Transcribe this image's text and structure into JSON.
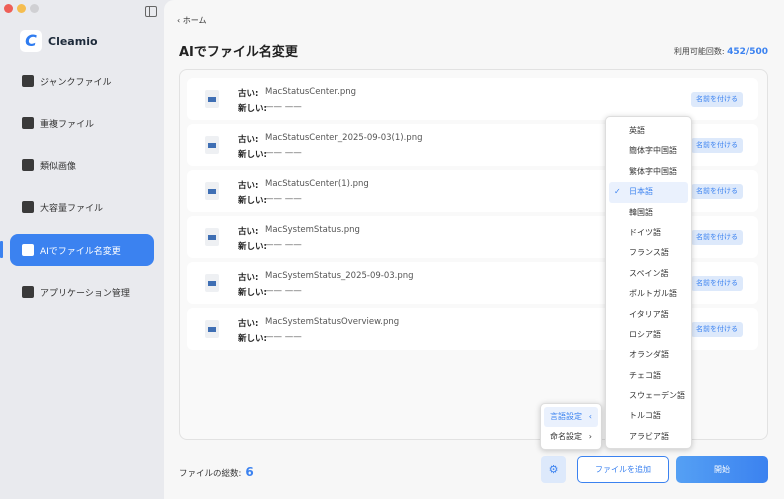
{
  "app": {
    "name": "Cleamio"
  },
  "sidebar": {
    "items": [
      {
        "label": "ジャンクファイル",
        "icon": "broom-icon"
      },
      {
        "label": "重複ファイル",
        "icon": "folder-icon"
      },
      {
        "label": "類似画像",
        "icon": "image-icon"
      },
      {
        "label": "大容量ファイル",
        "icon": "archive-icon"
      },
      {
        "label": "AIでファイル名変更",
        "icon": "ai-file-icon",
        "active": true
      },
      {
        "label": "アプリケーション管理",
        "icon": "app-store-icon"
      }
    ]
  },
  "header": {
    "back": "ホーム",
    "title": "AIでファイル名変更",
    "usage_label": "利用可能回数:",
    "usage_value": "452/500"
  },
  "files": [
    {
      "old_label": "古い:",
      "old": "MacStatusCenter.png",
      "new_label": "新しい:",
      "new": "—— ——",
      "action": "名前を付ける"
    },
    {
      "old_label": "古い:",
      "old": "MacStatusCenter_2025-09-03(1).png",
      "new_label": "新しい:",
      "new": "—— ——",
      "action": "名前を付ける"
    },
    {
      "old_label": "古い:",
      "old": "MacStatusCenter(1).png",
      "new_label": "新しい:",
      "new": "—— ——",
      "action": "名前を付ける"
    },
    {
      "old_label": "古い:",
      "old": "MacSystemStatus.png",
      "new_label": "新しい:",
      "new": "—— ——",
      "action": "名前を付ける"
    },
    {
      "old_label": "古い:",
      "old": "MacSystemStatus_2025-09-03.png",
      "new_label": "新しい:",
      "new": "—— ——",
      "action": "名前を付ける"
    },
    {
      "old_label": "古い:",
      "old": "MacSystemStatusOverview.png",
      "new_label": "新しい:",
      "new": "—— ——",
      "action": "名前を付ける"
    }
  ],
  "footer": {
    "total_label": "ファイルの総数:",
    "total": "6",
    "add_files": "ファイルを追加",
    "start": "開始"
  },
  "settings_menu": {
    "items": [
      {
        "label": "言語設定",
        "chevron": "‹",
        "selected": true
      },
      {
        "label": "命名設定",
        "chevron": "›"
      }
    ]
  },
  "language_menu": {
    "selected": "日本語",
    "check": "✓",
    "items": [
      "英語",
      "簡体字中国語",
      "繁体字中国語",
      "日本語",
      "韓国語",
      "ドイツ語",
      "フランス語",
      "スペイン語",
      "ポルトガル語",
      "イタリア語",
      "ロシア語",
      "オランダ語",
      "チェコ語",
      "スウェーデン語",
      "トルコ語",
      "アラビア語"
    ]
  },
  "colors": {
    "accent": "#3b82f0",
    "sidebar_bg": "#e9eaee"
  }
}
